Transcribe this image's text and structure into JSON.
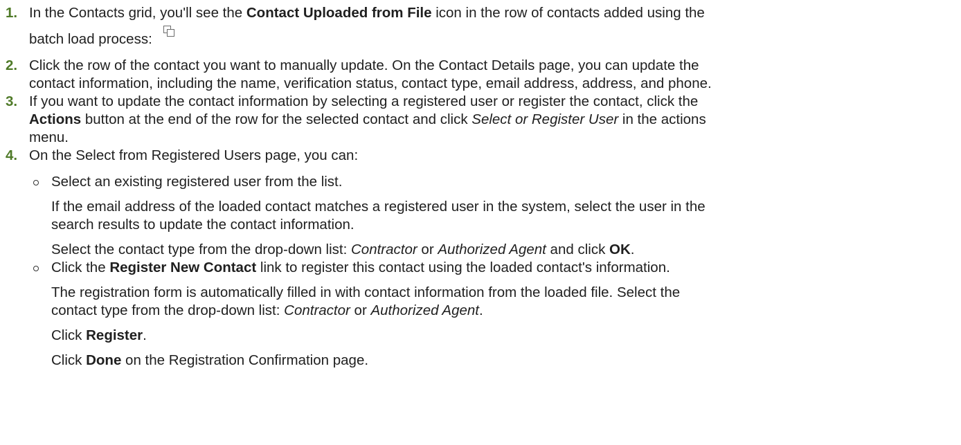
{
  "steps": [
    {
      "number": "1.",
      "line1": {
        "a": "In the Contacts grid, you'll see the ",
        "b": "Contact Uploaded from File",
        "c": " icon in the row of contacts added using the"
      },
      "line2": "batch load process:",
      "icon": "contact-uploaded-from-file-icon"
    },
    {
      "number": "2.",
      "line1": "Click the row of the contact you want to manually update. On the Contact Details page, you can update the",
      "line2": "contact information, including the name, verification status, contact type, email address, address, and phone."
    },
    {
      "number": "3.",
      "line1": "If you want to update the contact information by selecting a registered user or register the contact, click the",
      "line2": {
        "b": "Actions",
        "a": " button at the end of the row for the selected contact and click ",
        "i": "Select or Register User",
        "c": " in the actions"
      },
      "line3": "menu."
    },
    {
      "number": "4.",
      "line1": "On the Select from Registered Users page, you can:",
      "bullets": [
        {
          "text": "Select an existing registered user from the list.",
          "p1": {
            "l1": "If the email address of the loaded contact matches a registered user in the system, select the user in the",
            "l2": "search results to update the contact information."
          },
          "p2": {
            "a": "Select the contact type from the drop-down list: ",
            "i1": "Contractor",
            "or": " or ",
            "i2": "Authorized Agent",
            "and": " and click ",
            "b": "OK",
            "end": "."
          }
        },
        {
          "text": {
            "a": "Click the ",
            "b": "Register New Contact",
            "c": " link to register this contact using the loaded contact's information."
          },
          "p1": {
            "l1": "The registration form is automatically filled in with contact information from the loaded file. Select the",
            "l2": {
              "a": "contact type from the drop-down list: ",
              "i1": "Contractor",
              "or": " or ",
              "i2": "Authorized Agent",
              "end": "."
            }
          },
          "p2": {
            "a": "Click ",
            "b": "Register",
            "end": "."
          },
          "p3": {
            "a": "Click ",
            "b": "Done",
            "c": " on the Registration Confirmation page."
          }
        }
      ]
    }
  ]
}
